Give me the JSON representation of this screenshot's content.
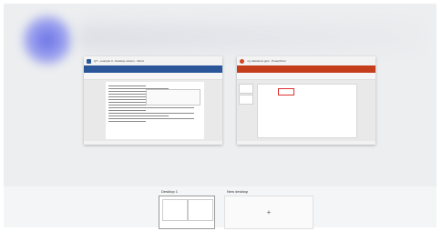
{
  "windows": [
    {
      "title": "QT - example 0 - Desktop column - Word",
      "app": "word"
    },
    {
      "title": "my slideshow pptx - PowerPoint",
      "app": "powerpoint"
    }
  ],
  "desktops": {
    "desktop1_label": "Desktop 1",
    "new_desktop_label": "New desktop",
    "new_desktop_plus": "+"
  },
  "colors": {
    "word_accent": "#2b579a",
    "powerpoint_accent": "#c43e1c",
    "wallpaper_glow": "#6d74e6"
  },
  "icons": [
    "word-app-icon",
    "powerpoint-app-icon",
    "plus-icon"
  ]
}
